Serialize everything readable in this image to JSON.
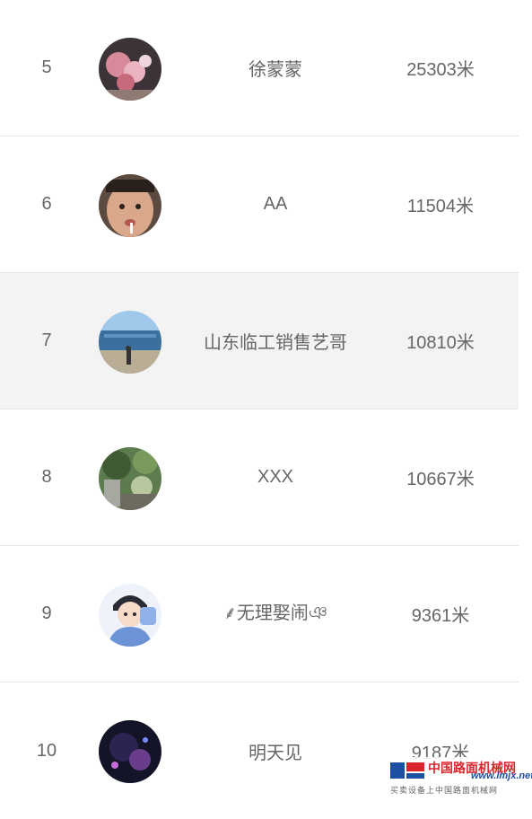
{
  "leaderboard": {
    "rows": [
      {
        "rank": "5",
        "name": "徐蒙蒙",
        "distance": "25303米",
        "avatar": "avatar-pink-flowers"
      },
      {
        "rank": "6",
        "name": "AA",
        "distance": "11504米",
        "avatar": "avatar-man-face"
      },
      {
        "rank": "7",
        "name": "山东临工销售艺哥",
        "distance": "10810米",
        "avatar": "avatar-building"
      },
      {
        "rank": "8",
        "name": "XXX",
        "distance": "10667米",
        "avatar": "avatar-garden"
      },
      {
        "rank": "9",
        "name": "⸙无理娶闹ঞ",
        "distance": "9361米",
        "avatar": "avatar-cartoon-boy"
      },
      {
        "rank": "10",
        "name": "明天见",
        "distance": "9187米",
        "avatar": "avatar-dark-night"
      }
    ]
  },
  "watermark": {
    "title": "中国路面机械网",
    "url": "www.lmjx.net",
    "subtitle": "买卖设备上中国路面机械网"
  }
}
